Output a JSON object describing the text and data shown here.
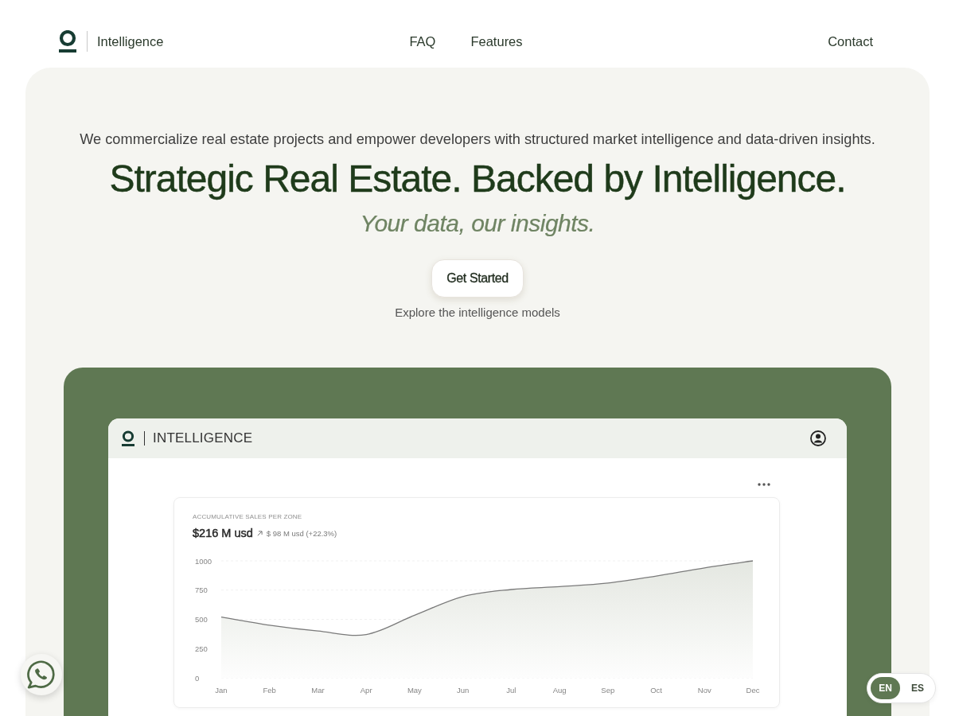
{
  "nav": {
    "brand": "Intelligence",
    "links": [
      "FAQ",
      "Features"
    ],
    "contact": "Contact"
  },
  "hero": {
    "tagline": "We commercialize real estate projects and empower developers with structured market intelligence and data-driven insights.",
    "title": "Strategic Real Estate. Backed by Intelligence.",
    "subtitle": "Your data, our insights.",
    "button": "Get Started",
    "note": "Explore the intelligence models"
  },
  "app_preview": {
    "brand": "INTELLIGENCE",
    "card": {
      "total": "$216 M usd",
      "change": "$ 98 M usd (+22.3%)",
      "chart_data": {
        "type": "area",
        "title": "ACCUMULATIVE SALES PER ZONE",
        "categories": [
          "Jan",
          "Feb",
          "Mar",
          "Apr",
          "May",
          "Jun",
          "Jul",
          "Aug",
          "Sep",
          "Oct",
          "Nov",
          "Dec"
        ],
        "values": [
          520,
          450,
          400,
          370,
          535,
          695,
          755,
          780,
          810,
          870,
          940,
          1000
        ],
        "ylim": [
          0,
          1000
        ],
        "yticks": [
          0,
          250,
          500,
          750,
          1000
        ]
      }
    }
  },
  "language_switch": [
    {
      "label": "EN",
      "selected": true
    },
    {
      "label": "ES",
      "selected": false
    }
  ]
}
